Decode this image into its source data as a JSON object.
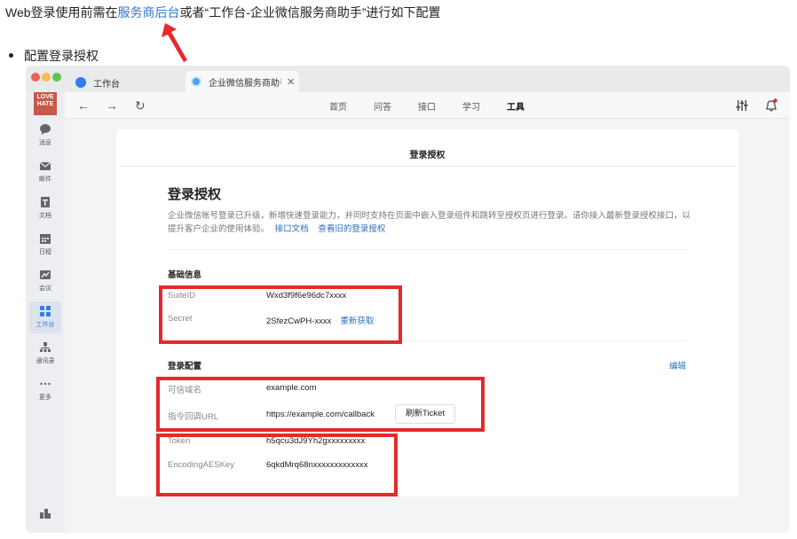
{
  "intro": {
    "prefix": "Web登录使用前需在",
    "link": "服务商后台",
    "suffix": "或者“工作台-企业微信服务商助手”进行如下配置"
  },
  "bullet": "配置登录授权",
  "colors": {
    "annotation_red": "#e5292a",
    "link_blue": "#3476d2",
    "accent_blue": "#2d7ff0"
  },
  "window": {
    "tabs": [
      {
        "label": "工作台",
        "icon": "workbench-icon"
      },
      {
        "label": "企业微信服务商助手",
        "icon": "assistant-icon",
        "close": "✕"
      }
    ],
    "nav": {
      "back": "←",
      "forward": "→",
      "reload": "↻",
      "tabs": [
        "首页",
        "问答",
        "接口",
        "学习",
        "工具"
      ],
      "active_tab": "工具"
    },
    "sidebar": {
      "avatar_text": "LOVE HATE",
      "items": [
        {
          "label": "消息",
          "icon": "message-icon"
        },
        {
          "label": "邮件",
          "icon": "mail-icon"
        },
        {
          "label": "文档",
          "icon": "doc-icon"
        },
        {
          "label": "日程",
          "icon": "calendar-icon"
        },
        {
          "label": "会议",
          "icon": "meeting-icon"
        },
        {
          "label": "工作台",
          "icon": "workbench-grid-icon"
        },
        {
          "label": "通讯录",
          "icon": "contacts-icon"
        },
        {
          "label": "更多",
          "icon": "more-icon"
        }
      ]
    },
    "panel": {
      "header": "登录授权",
      "title": "登录授权",
      "desc": "企业微信帐号登录已升级，新增快速登录能力，并同时支持在页面中嵌入登录组件和跳转至授权页进行登录。请你接入最新登录授权接口，以提升客户企业的使用体验。",
      "desc_link1": "接口文档",
      "desc_link2": "查看旧的登录授权",
      "basic_section": "基础信息",
      "suite_id_label": "SuiteID",
      "suite_id_value": "Wxd3f9f6e96dc7xxxx",
      "secret_label": "Secret",
      "secret_value": "2SfezCwPH-xxxx",
      "secret_refresh": "重新获取",
      "config_section": "登录配置",
      "edit": "编辑",
      "domain_label": "可信域名",
      "domain_value": "example.com",
      "callback_label": "指令回调URL",
      "callback_value": "https://example.com/callback",
      "refresh_ticket": "刷新Ticket",
      "token_label": "Token",
      "token_value": "h5qcu3dJ9Yh2gxxxxxxxxx",
      "aes_label": "EncodingAESKey",
      "aes_value": "6qkdMrq68nxxxxxxxxxxxxx"
    }
  }
}
